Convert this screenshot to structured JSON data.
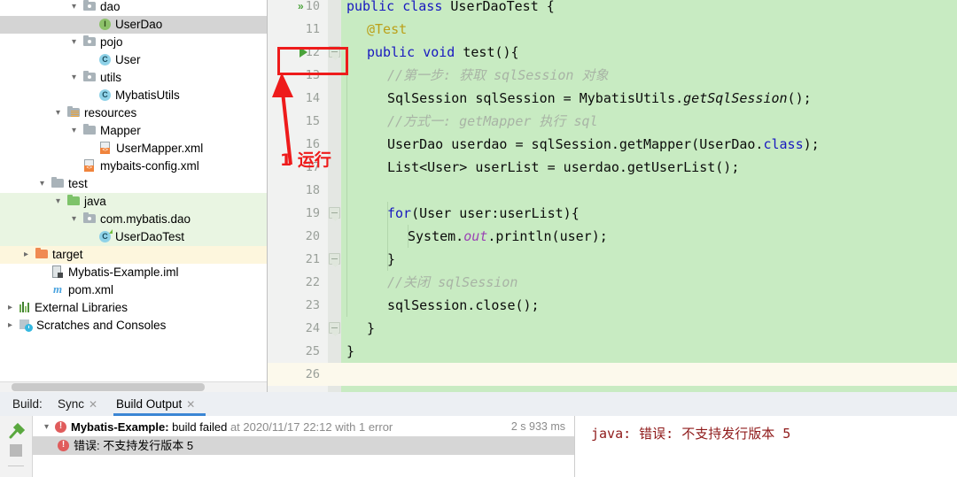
{
  "project_tree": {
    "rows": [
      {
        "label": "dao",
        "indent": 4,
        "icon": "folder-pkg",
        "twisty": "v",
        "state": "clipped"
      },
      {
        "label": "UserDao",
        "indent": 5,
        "icon": "interface",
        "twisty": "",
        "state": "selected"
      },
      {
        "label": "pojo",
        "indent": 4,
        "icon": "folder-pkg",
        "twisty": "v",
        "state": ""
      },
      {
        "label": "User",
        "indent": 5,
        "icon": "class",
        "twisty": "",
        "state": ""
      },
      {
        "label": "utils",
        "indent": 4,
        "icon": "folder-pkg",
        "twisty": "v",
        "state": ""
      },
      {
        "label": "MybatisUtils",
        "indent": 5,
        "icon": "class",
        "twisty": "",
        "state": ""
      },
      {
        "label": "resources",
        "indent": 3,
        "icon": "folder-resources",
        "twisty": "v",
        "state": ""
      },
      {
        "label": "Mapper",
        "indent": 4,
        "icon": "folder",
        "twisty": "v",
        "state": ""
      },
      {
        "label": "UserMapper.xml",
        "indent": 5,
        "icon": "xml",
        "twisty": "",
        "state": ""
      },
      {
        "label": "mybaits-config.xml",
        "indent": 4,
        "icon": "xml",
        "twisty": "",
        "state": ""
      },
      {
        "label": "test",
        "indent": 2,
        "icon": "folder",
        "twisty": "v",
        "state": ""
      },
      {
        "label": "java",
        "indent": 3,
        "icon": "folder-green",
        "twisty": "v",
        "state": "testsrc"
      },
      {
        "label": "com.mybatis.dao",
        "indent": 4,
        "icon": "folder-pkg",
        "twisty": "v",
        "state": "testsrc"
      },
      {
        "label": "UserDaoTest",
        "indent": 5,
        "icon": "class-test",
        "twisty": "",
        "state": "testsrc"
      },
      {
        "label": "target",
        "indent": 1,
        "icon": "folder-orange",
        "twisty": ">",
        "state": "excluded"
      },
      {
        "label": "Mybatis-Example.iml",
        "indent": 2,
        "icon": "iml",
        "twisty": "",
        "state": ""
      },
      {
        "label": "pom.xml",
        "indent": 2,
        "icon": "maven",
        "twisty": "",
        "state": ""
      },
      {
        "label": "External Libraries",
        "indent": 0,
        "icon": "libs",
        "twisty": ">",
        "state": ""
      },
      {
        "label": "Scratches and Consoles",
        "indent": 0,
        "icon": "scratch",
        "twisty": ">",
        "state": ""
      }
    ]
  },
  "editor": {
    "first_line": 10,
    "caret_line": 26,
    "lines": [
      {
        "n": 10,
        "indent": 0,
        "tokens": [
          {
            "t": "public ",
            "c": "kw"
          },
          {
            "t": "class ",
            "c": "kw"
          },
          {
            "t": "UserDaoTest {",
            "c": ""
          }
        ]
      },
      {
        "n": 11,
        "indent": 1,
        "tokens": [
          {
            "t": "@Test",
            "c": "anno"
          }
        ]
      },
      {
        "n": 12,
        "indent": 1,
        "tokens": [
          {
            "t": "public ",
            "c": "kw"
          },
          {
            "t": "void ",
            "c": "kw"
          },
          {
            "t": "test(){",
            "c": ""
          }
        ]
      },
      {
        "n": 13,
        "indent": 2,
        "tokens": [
          {
            "t": "//第一步: 获取 sqlSession 对象",
            "c": "cmt"
          }
        ]
      },
      {
        "n": 14,
        "indent": 2,
        "tokens": [
          {
            "t": "SqlSession sqlSession = MybatisUtils.",
            "c": ""
          },
          {
            "t": "getSqlSession",
            "c": "stat"
          },
          {
            "t": "();",
            "c": ""
          }
        ]
      },
      {
        "n": 15,
        "indent": 2,
        "tokens": [
          {
            "t": "//方式一: getMapper 执行 sql",
            "c": "cmt"
          }
        ]
      },
      {
        "n": 16,
        "indent": 2,
        "tokens": [
          {
            "t": "UserDao userdao = sqlSession.getMapper(UserDao.",
            "c": ""
          },
          {
            "t": "class",
            "c": "kw"
          },
          {
            "t": ");",
            "c": ""
          }
        ]
      },
      {
        "n": 17,
        "indent": 2,
        "tokens": [
          {
            "t": "List<User> userList = userdao.getUserList();",
            "c": ""
          }
        ]
      },
      {
        "n": 18,
        "indent": 0,
        "tokens": []
      },
      {
        "n": 19,
        "indent": 2,
        "tokens": [
          {
            "t": "for",
            "c": "kw"
          },
          {
            "t": "(User user:userList){",
            "c": ""
          }
        ]
      },
      {
        "n": 20,
        "indent": 3,
        "tokens": [
          {
            "t": "System.",
            "c": ""
          },
          {
            "t": "out",
            "c": "field"
          },
          {
            "t": ".println(user);",
            "c": ""
          }
        ]
      },
      {
        "n": 21,
        "indent": 2,
        "tokens": [
          {
            "t": "}",
            "c": ""
          }
        ]
      },
      {
        "n": 22,
        "indent": 2,
        "tokens": [
          {
            "t": "//关闭 sqlSession",
            "c": "cmt"
          }
        ]
      },
      {
        "n": 23,
        "indent": 2,
        "tokens": [
          {
            "t": "sqlSession.close();",
            "c": ""
          }
        ]
      },
      {
        "n": 24,
        "indent": 1,
        "tokens": [
          {
            "t": "}",
            "c": ""
          }
        ]
      },
      {
        "n": 25,
        "indent": 0,
        "tokens": [
          {
            "t": "}",
            "c": ""
          }
        ]
      },
      {
        "n": 26,
        "indent": 0,
        "tokens": []
      }
    ],
    "gutter_icons": {
      "run_all_line": 10,
      "run_method_line": 12
    },
    "fold_marker_lines": [
      12,
      19,
      21,
      24
    ]
  },
  "annotation": {
    "label": "1 运行",
    "color": "#ee1b1b"
  },
  "build_panel": {
    "prefix_label": "Build:",
    "tabs": [
      {
        "label": "Sync",
        "closable": true,
        "active": false
      },
      {
        "label": "Build Output",
        "closable": true,
        "active": true
      }
    ],
    "rows": [
      {
        "twisty": "v",
        "icon": "error-icon",
        "bold": "Mybatis-Example:",
        "normal": " build failed ",
        "dim": "at 2020/11/17 22:12 with 1 error",
        "time": "2 s 933 ms",
        "selected": false
      },
      {
        "twisty": "",
        "icon": "error-icon",
        "bold": "",
        "normal": "错误: 不支持发行版本 5",
        "dim": "",
        "time": "",
        "selected": true
      }
    ],
    "console_text": "java: 错误: 不支持发行版本 5"
  },
  "colors": {
    "editor_bg": "#c8ebc2",
    "gutter_bg": "#f1f2f1",
    "caret_line": "#fcf9ec",
    "accent": "#3b86d4",
    "annotation_red": "#ee1b1b",
    "error_red": "#e05c5c",
    "console_red": "#8f1a1a"
  }
}
